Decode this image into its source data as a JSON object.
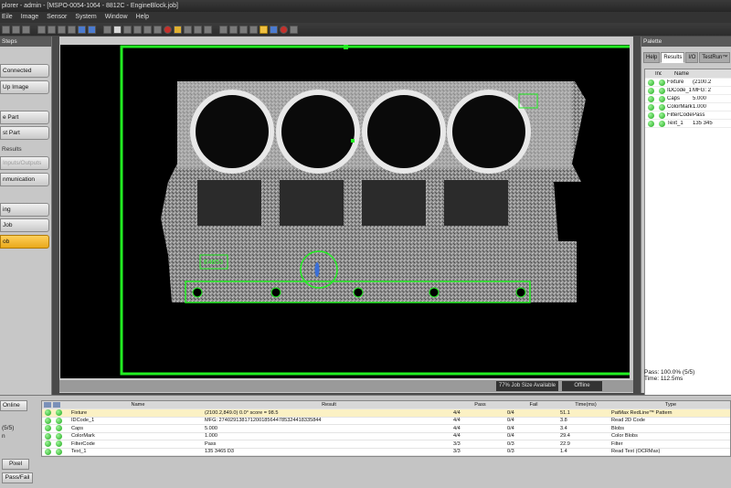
{
  "window": {
    "title": "plorer - admin - [MSPO-0054-1064 - 8812C - EngineBlock.job]"
  },
  "menu": [
    "Eile",
    "Image",
    "Sensor",
    "System",
    "Window",
    "Help"
  ],
  "left_panel": {
    "header": "Steps",
    "buttons": [
      {
        "label": "Connected",
        "state": "normal"
      },
      {
        "label": "Up Image",
        "state": "normal"
      },
      {
        "label": "e Part",
        "state": "normal"
      },
      {
        "label": "st Part",
        "state": "normal"
      },
      {
        "label": "Results",
        "state": "section"
      },
      {
        "label": "Inputs/Outputs",
        "state": "disabled"
      },
      {
        "label": "nmunication",
        "state": "normal"
      },
      {
        "label": "ing",
        "state": "normal"
      },
      {
        "label": "Job",
        "state": "normal"
      },
      {
        "label": "ob",
        "state": "active"
      }
    ]
  },
  "image": {
    "status_capacity": "77% Job Size Available",
    "status_mode": "Offline",
    "tool_label": "E4B53"
  },
  "palette": {
    "header": "Palette",
    "tabs": [
      "Help",
      "Results",
      "I/O",
      "TestRun™"
    ],
    "active_tab": "Results",
    "columns": [
      "Ind",
      "Name"
    ],
    "rows": [
      {
        "name": "Fixture",
        "value": "(2100.2"
      },
      {
        "name": "IDCode_1",
        "value": "MFG: 2"
      },
      {
        "name": "Caps",
        "value": "5.000"
      },
      {
        "name": "ColorMark",
        "value": "1.000"
      },
      {
        "name": "FilterCode",
        "value": "Pass"
      },
      {
        "name": "Text_1",
        "value": "135 345"
      }
    ],
    "pass_summary": "Pass: 100.0% (5/5)",
    "time_summary": "Time: 112.5ms"
  },
  "results": {
    "online_label": "Online",
    "side_label_1": "(5/5)",
    "side_label_2": "n",
    "pixel_button": "Pixel",
    "passfail_button": "Pass/Fail",
    "columns": {
      "name": "Name",
      "result": "Result",
      "pass": "Pass",
      "fail": "Fail",
      "time": "Time(ms)",
      "type": "Type"
    },
    "rows": [
      {
        "name": "Fixture",
        "result": "(2100.2,849.0) 0.0° score = 98.5",
        "pass": "4/4",
        "fail": "0/4",
        "time": "51.1",
        "type": "PatMax RedLine™ Pattern",
        "highlight": true
      },
      {
        "name": "IDCode_1",
        "result": "MFG: 274029138171200185644785324418335844",
        "pass": "4/4",
        "fail": "0/4",
        "time": "3.8",
        "type": "Read 2D Code",
        "highlight": false
      },
      {
        "name": "Caps",
        "result": "5.000",
        "pass": "4/4",
        "fail": "0/4",
        "time": "3.4",
        "type": "Blobs",
        "highlight": false
      },
      {
        "name": "ColorMark",
        "result": "1.000",
        "pass": "4/4",
        "fail": "0/4",
        "time": "29.4",
        "type": "Color Blobs",
        "highlight": false
      },
      {
        "name": "FilterCode",
        "result": "Pass",
        "pass": "3/3",
        "fail": "0/3",
        "time": "22.9",
        "type": "Filter",
        "highlight": false
      },
      {
        "name": "Text_1",
        "result": "135 3465 D3",
        "pass": "3/3",
        "fail": "0/3",
        "time": "1.4",
        "type": "Read Text (OCRMax)",
        "highlight": false
      }
    ]
  },
  "colors": {
    "accent": "#e9a91b",
    "overlay": "#22ee22",
    "pass": "#1ea81a"
  }
}
